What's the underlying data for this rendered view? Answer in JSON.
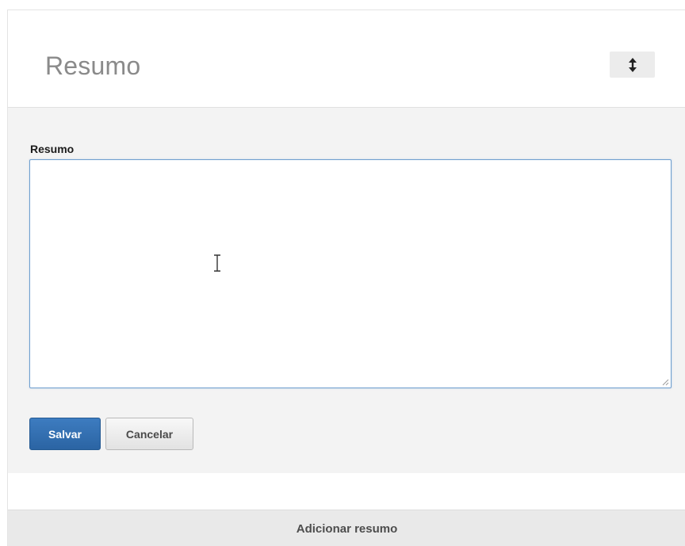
{
  "header": {
    "title": "Resumo",
    "reorder_icon": "up-down-arrow-icon"
  },
  "form": {
    "field_label": "Resumo",
    "textarea_value": "",
    "save_label": "Salvar",
    "cancel_label": "Cancelar"
  },
  "footer": {
    "add_label": "Adicionar resumo"
  },
  "colors": {
    "primary_button": "#2f6dae",
    "focus_border": "#6f9fcf",
    "form_background": "#f3f3f3"
  }
}
